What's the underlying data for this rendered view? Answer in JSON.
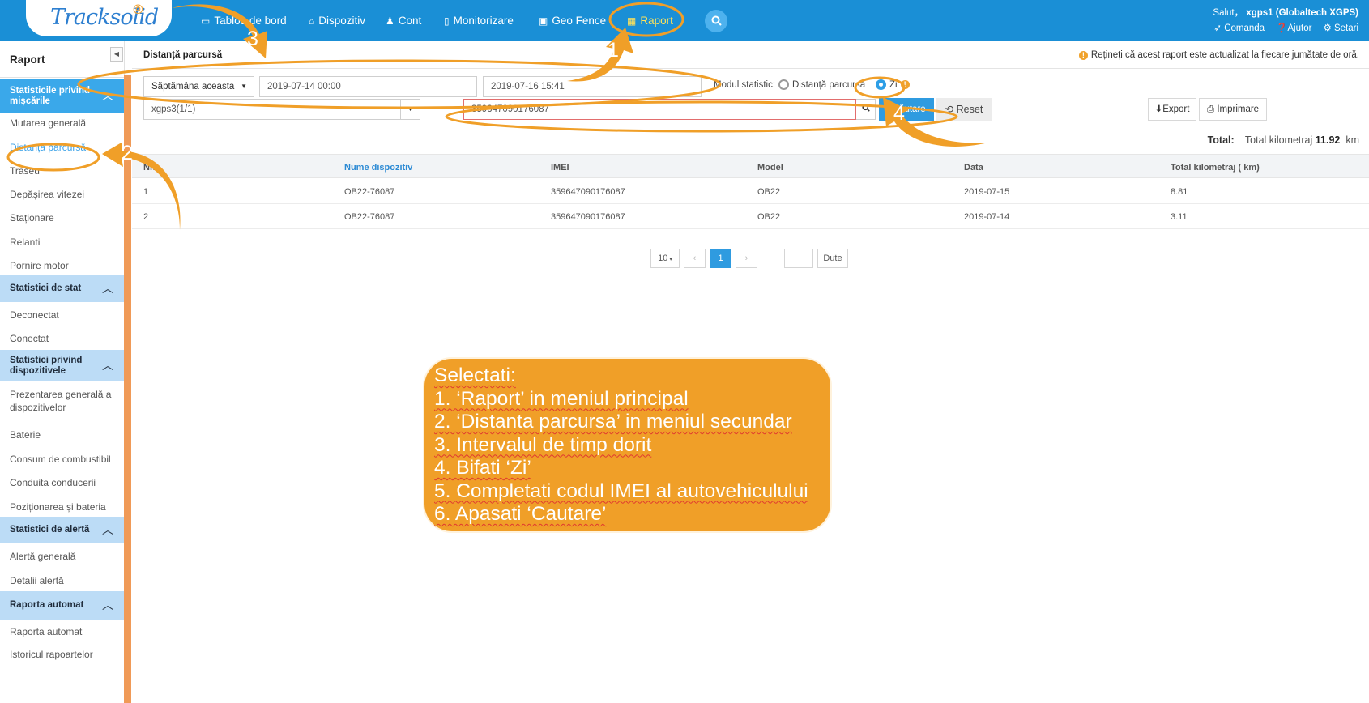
{
  "header": {
    "logo": "Tracksolid",
    "nav": [
      {
        "label": "Tablou de bord",
        "icon": "dashboard-icon"
      },
      {
        "label": "Dispozitiv",
        "icon": "car-icon"
      },
      {
        "label": "Cont",
        "icon": "users-icon"
      },
      {
        "label": "Monitorizare",
        "icon": "map-icon"
      },
      {
        "label": "Geo Fence",
        "icon": "fence-icon"
      },
      {
        "label": "Raport",
        "icon": "table-icon"
      }
    ],
    "greeting": "Salut，",
    "user": "xgps1 (Globaltech XGPS)",
    "links": [
      {
        "label": "Comanda",
        "icon": "send-icon"
      },
      {
        "label": "Ajutor",
        "icon": "help-icon"
      },
      {
        "label": "Setari",
        "icon": "gear-icon"
      }
    ]
  },
  "sidebar": {
    "title": "Raport",
    "sections": [
      {
        "title": "Statisticile privind mișcările",
        "items": [
          "Mutarea generală",
          "Distanță parcursă",
          "Traseu",
          "Depășirea vitezei",
          "Staționare",
          "Relanti",
          "Pornire motor"
        ]
      },
      {
        "title": "Statistici de stat",
        "items": [
          "Deconectat",
          "Conectat"
        ]
      },
      {
        "title": "Statistici privind dispozitivele",
        "items": [
          "Prezentarea generală a dispozitivelor",
          "Baterie",
          "Consum de combustibil",
          "Conduita conducerii",
          "Poziționarea și bateria"
        ]
      },
      {
        "title": "Statistici de alertă",
        "items": [
          "Alertă generală",
          "Detalii alertă"
        ]
      },
      {
        "title": "Raporta automat",
        "items": [
          "Raporta automat",
          "Istoricul rapoartelor"
        ]
      }
    ]
  },
  "page": {
    "title": "Distanță parcursă",
    "notice": "Rețineți că acest raport este actualizat la fiecare jumătate de oră."
  },
  "filters": {
    "period": "Săptămâna aceasta",
    "start": "2019-07-14 00:00",
    "end": "2019-07-16 15:41",
    "stat_mode_label": "Modul statistic:",
    "mode_options": [
      "Distanță parcursă",
      "Zi"
    ],
    "mode_selected": "Zi",
    "account": "xgps3(1/1)",
    "imei": "359647090176087",
    "search_label": "Căutare",
    "reset_label": "Reset",
    "export_label": "Export",
    "print_label": "Imprimare"
  },
  "summary": {
    "label": "Total:",
    "text": "Total kilometraj",
    "value": "11.92",
    "unit": "km"
  },
  "table": {
    "columns": [
      "Nr.",
      "Nume dispozitiv",
      "IMEI",
      "Model",
      "Data",
      "Total kilometraj ( km)"
    ],
    "rows": [
      [
        "1",
        "OB22-76087",
        "359647090176087",
        "OB22",
        "2019-07-15",
        "8.81"
      ],
      [
        "2",
        "OB22-76087",
        "359647090176087",
        "OB22",
        "2019-07-14",
        "3.11"
      ]
    ]
  },
  "pagination": {
    "page_size": "10",
    "prev": "‹",
    "current": "1",
    "next": "›",
    "goto_label": "Dute"
  },
  "annotation": {
    "lines": [
      "Selectati:",
      "1. ‘Raport’ in meniul principal",
      "2. ‘Distanta parcursa’ in meniul secundar",
      "3. Intervalul de timp dorit",
      "4. Bifati ‘Zi’",
      "5. Completati codul IMEI al autovehiculului",
      "6. Apasati ‘Cautare’"
    ],
    "markers": [
      "1",
      "2",
      "3",
      "4"
    ]
  },
  "colors": {
    "header": "#1a8fd6",
    "accent": "#2f9be0",
    "active_nav": "#ffe25a",
    "annotation": "#f09f28"
  }
}
